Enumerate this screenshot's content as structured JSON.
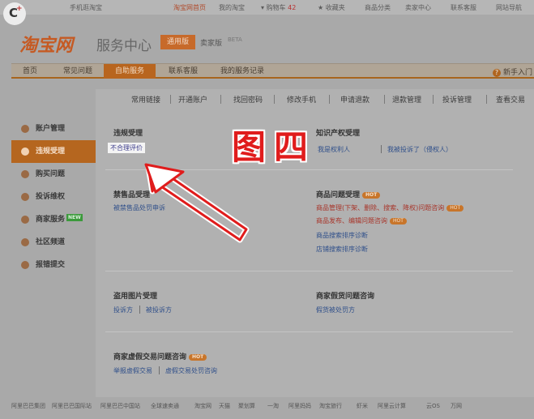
{
  "top_bar": {
    "mobile": "手机逛淘宝",
    "home": "淘宝网首页",
    "my_taobao": "我的淘宝",
    "cart_label": "购物车",
    "cart_count": "42",
    "favorites": "收藏夹",
    "categories": "商品分类",
    "seller_center": "卖家中心",
    "contact": "联系客服",
    "sitemap": "网站导航"
  },
  "brand": {
    "logo": "淘宝网",
    "service_title": "服务中心",
    "universal_button": "通用版",
    "seller_button": "卖家版",
    "beta": "BETA"
  },
  "nav": {
    "tabs": [
      "首页",
      "常见问题",
      "自助服务",
      "联系客服",
      "我的服务记录"
    ],
    "newbie": "新手入门"
  },
  "quick_links": [
    "常用链接",
    "开通账户",
    "找回密码",
    "修改手机",
    "申请退款",
    "退款管理",
    "投诉管理",
    "查看交易"
  ],
  "sidebar": {
    "items": [
      "账户管理",
      "违规受理",
      "购买问题",
      "投诉维权",
      "商家服务",
      "社区频道",
      "报错提交"
    ],
    "new_tag": "NEW"
  },
  "sections": {
    "violation": {
      "title": "违规受理",
      "link": "不合理评价"
    },
    "ip_rights": {
      "title": "知识产权受理",
      "link_owner": "我是权利人",
      "link_complained": "我被投诉了（侵权人）"
    },
    "prohibited": {
      "title": "禁售品受理",
      "link": "被禁售品处罚申诉"
    },
    "product_issues": {
      "title": "商品问题受理",
      "links": [
        "商品管理(下架、删除、搜索、降权)问题咨询",
        "商品发布、编辑问题咨询",
        "商品搜索排序诊断",
        "店铺搜索排序诊断"
      ]
    },
    "image_theft": {
      "title": "盗用图片受理",
      "link_complain": "投诉方",
      "link_complained": "被投诉方"
    },
    "counterfeit": {
      "title": "商家假货问题咨询",
      "link": "假货被处罚方"
    },
    "fake_trade": {
      "title": "商家虚假交易问题咨询",
      "link_report": "举报虚假交易",
      "link_penalty": "虚假交易处罚咨询"
    },
    "hot_label": "HOT"
  },
  "annotation": {
    "stamp_text": "图四"
  },
  "footer": [
    "阿里巴巴集团",
    "阿里巴巴国际站",
    "阿里巴巴中国站",
    "全球速卖通",
    "淘宝网",
    "天猫",
    "聚划算",
    "一淘",
    "阿里妈妈",
    "淘宝旅行",
    "虾米",
    "阿里云计算",
    "云OS",
    "万网"
  ]
}
